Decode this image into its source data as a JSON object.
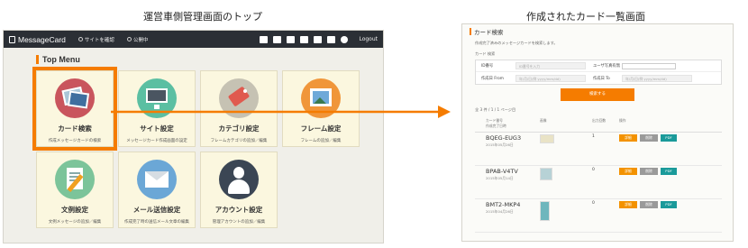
{
  "captions": {
    "left": "運営車側管理画面のトップ",
    "right": "作成されたカード一覧画面"
  },
  "topbar": {
    "brand": "MessageCard",
    "links": [
      "サイトを確認",
      "公開中"
    ],
    "logout": "Logout"
  },
  "top_menu": {
    "title": "Top Menu",
    "tiles": [
      {
        "title": "カード検索",
        "desc": "作成メッセージカードの検索",
        "color": "#c9555d",
        "icon": "photo-icon"
      },
      {
        "title": "サイト設定",
        "desc": "メッセージカード作成画面の設定",
        "color": "#5bbfa2",
        "icon": "monitor-icon"
      },
      {
        "title": "カテゴリ設定",
        "desc": "フレームカテゴリの追加／編集",
        "color": "#c6c2b3",
        "icon": "tag-icon"
      },
      {
        "title": "フレーム設定",
        "desc": "フレームの追加／編集",
        "color": "#f0963a",
        "icon": "frame-icon"
      },
      {
        "title": "文例設定",
        "desc": "文例メッセージの追加／編集",
        "color": "#7cc49a",
        "icon": "document-icon"
      },
      {
        "title": "メール送信設定",
        "desc": "作成完了時の送信メール文章の編集",
        "color": "#6ba7d6",
        "icon": "mail-icon"
      },
      {
        "title": "アカウント設定",
        "desc": "管理アカウントの追加／編集",
        "color": "#3b4654",
        "icon": "user-icon"
      }
    ]
  },
  "list_page": {
    "title": "カード検索",
    "description": "作成完了済みのメッセージカードを検索します。",
    "search_label": "カード 検索",
    "form": {
      "id_label": "ID番号",
      "id_placeholder": "ID番号を入力",
      "user_label": "ユーザ写真有無",
      "from_label": "作成日 From",
      "from_placeholder": "年/月/日(例 yyyy/mm/dd)",
      "to_label": "作成日 To",
      "to_placeholder": "年/月/日(例 yyyy/mm/dd)"
    },
    "search_button": "検索する",
    "count": "全 3 件 / 1 / 1 ページ目",
    "columns": {
      "id": "カード番号",
      "id_sub": "作成完了日時",
      "image": "画像",
      "output": "出力回数",
      "ops": "操作"
    },
    "rows": [
      {
        "code": "BQEG-EUG3",
        "date": "2015年05月26日",
        "count": "1"
      },
      {
        "code": "BPAB-V4TV",
        "date": "2015年05月14日",
        "count": "0"
      },
      {
        "code": "BMT2-MKP4",
        "date": "2015年04月26日",
        "count": "0"
      }
    ],
    "buttons": {
      "edit": "詳細",
      "delete": "削除",
      "pdf": "PDF"
    }
  },
  "colors": {
    "accent": "#f57c00",
    "topbar": "#2b2f35"
  }
}
